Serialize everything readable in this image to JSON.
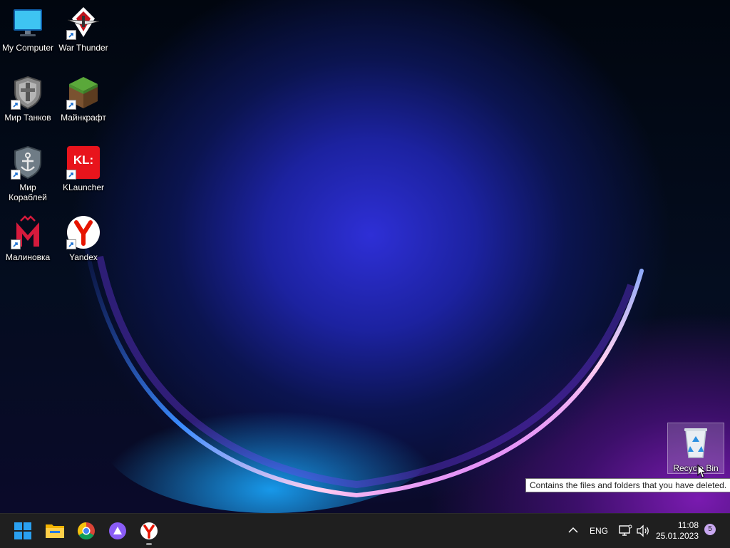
{
  "desktop": {
    "icons": [
      {
        "label": "My Computer",
        "icon": "computer-monitor-icon"
      },
      {
        "label": "War Thunder",
        "icon": "war-thunder-icon"
      },
      {
        "label": "Мир Танков",
        "icon": "tank-shield-icon"
      },
      {
        "label": "Майнкрафт",
        "icon": "minecraft-grass-block-icon"
      },
      {
        "label": "Мир Кораблей",
        "icon": "ship-anchor-shield-icon"
      },
      {
        "label": "KLauncher",
        "icon": "klauncher-icon",
        "badge": "KL:"
      },
      {
        "label": "Малиновка",
        "icon": "malinovka-m-icon"
      },
      {
        "label": "Yandex",
        "icon": "yandex-browser-icon"
      }
    ],
    "recycle_bin": {
      "label": "Recycle Bin",
      "icon": "recycle-bin-icon"
    },
    "tooltip": "Contains the files and folders that you have deleted."
  },
  "taskbar": {
    "apps": [
      {
        "name": "Start",
        "icon": "windows-start-icon"
      },
      {
        "name": "File Explorer",
        "icon": "folder-icon"
      },
      {
        "name": "Chrome",
        "icon": "chrome-icon"
      },
      {
        "name": "Alice",
        "icon": "alice-assistant-icon"
      },
      {
        "name": "Yandex Browser",
        "icon": "yandex-browser-icon"
      }
    ],
    "tray": {
      "language": "ENG",
      "time": "11:08",
      "date": "25.01.2023",
      "notification_count": "5"
    }
  },
  "colors": {
    "taskbar": "#1f1f1f",
    "windows_blue": "#2aa0f0",
    "yandex_red": "#e61400",
    "klauncher_red": "#e8141c"
  }
}
